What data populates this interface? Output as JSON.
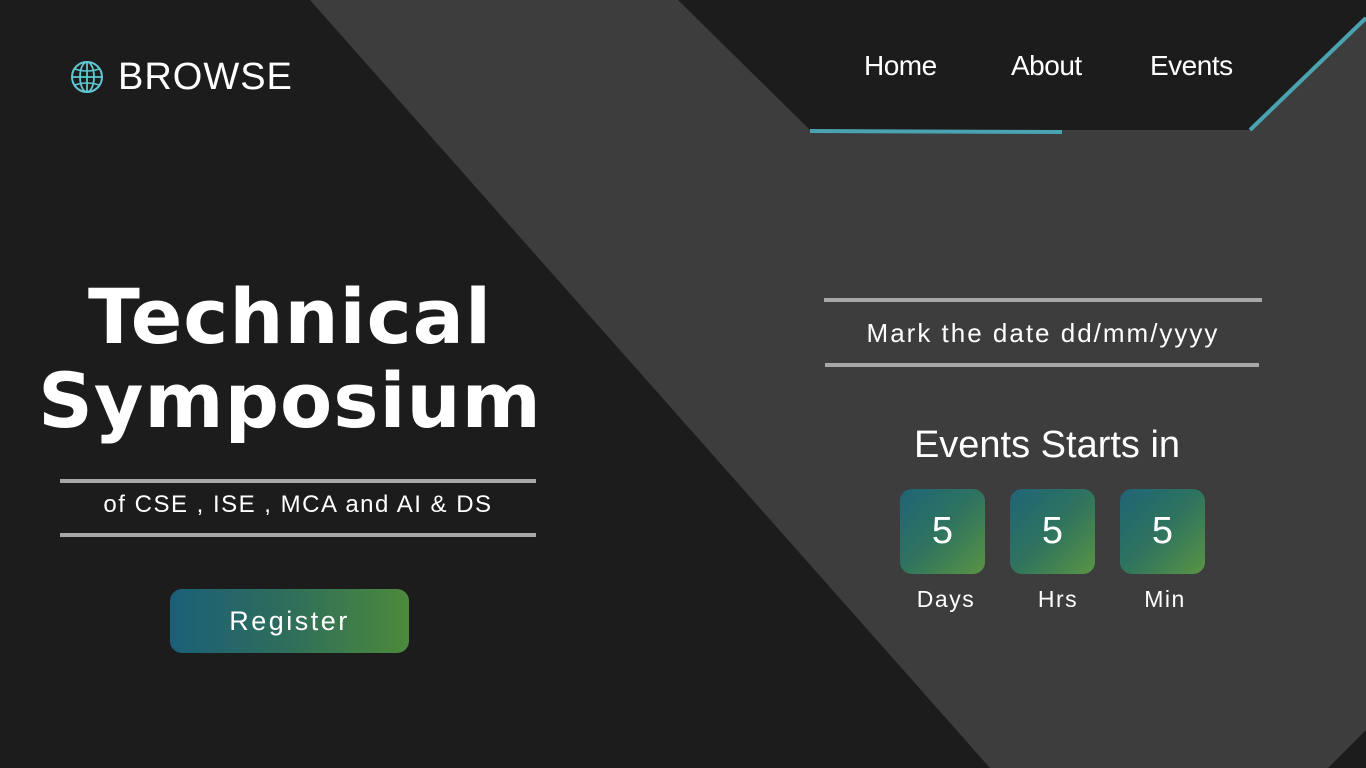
{
  "header": {
    "brand": {
      "icon": "globe-icon",
      "label": "BROWSE"
    },
    "nav": [
      {
        "label": "Home",
        "active": true
      },
      {
        "label": "About",
        "active": false
      },
      {
        "label": "Events",
        "active": false
      }
    ]
  },
  "hero": {
    "title_line1": "Technical",
    "title_line2": "Symposium",
    "subtitle": "of CSE , ISE , MCA and AI & DS",
    "register_label": "Register"
  },
  "event": {
    "mark_date": "Mark the date dd/mm/yyyy",
    "starts_title": "Events Starts in",
    "countdown": [
      {
        "value": "5",
        "label": "Days"
      },
      {
        "value": "5",
        "label": "Hrs"
      },
      {
        "value": "5",
        "label": "Min"
      }
    ]
  },
  "colors": {
    "background_dark": "#1c1c1d",
    "background_panel": "#3d3d3e",
    "accent_teal": "#4aa3b0",
    "gradient_start": "#1a5f78",
    "gradient_end": "#4c8a3c"
  }
}
